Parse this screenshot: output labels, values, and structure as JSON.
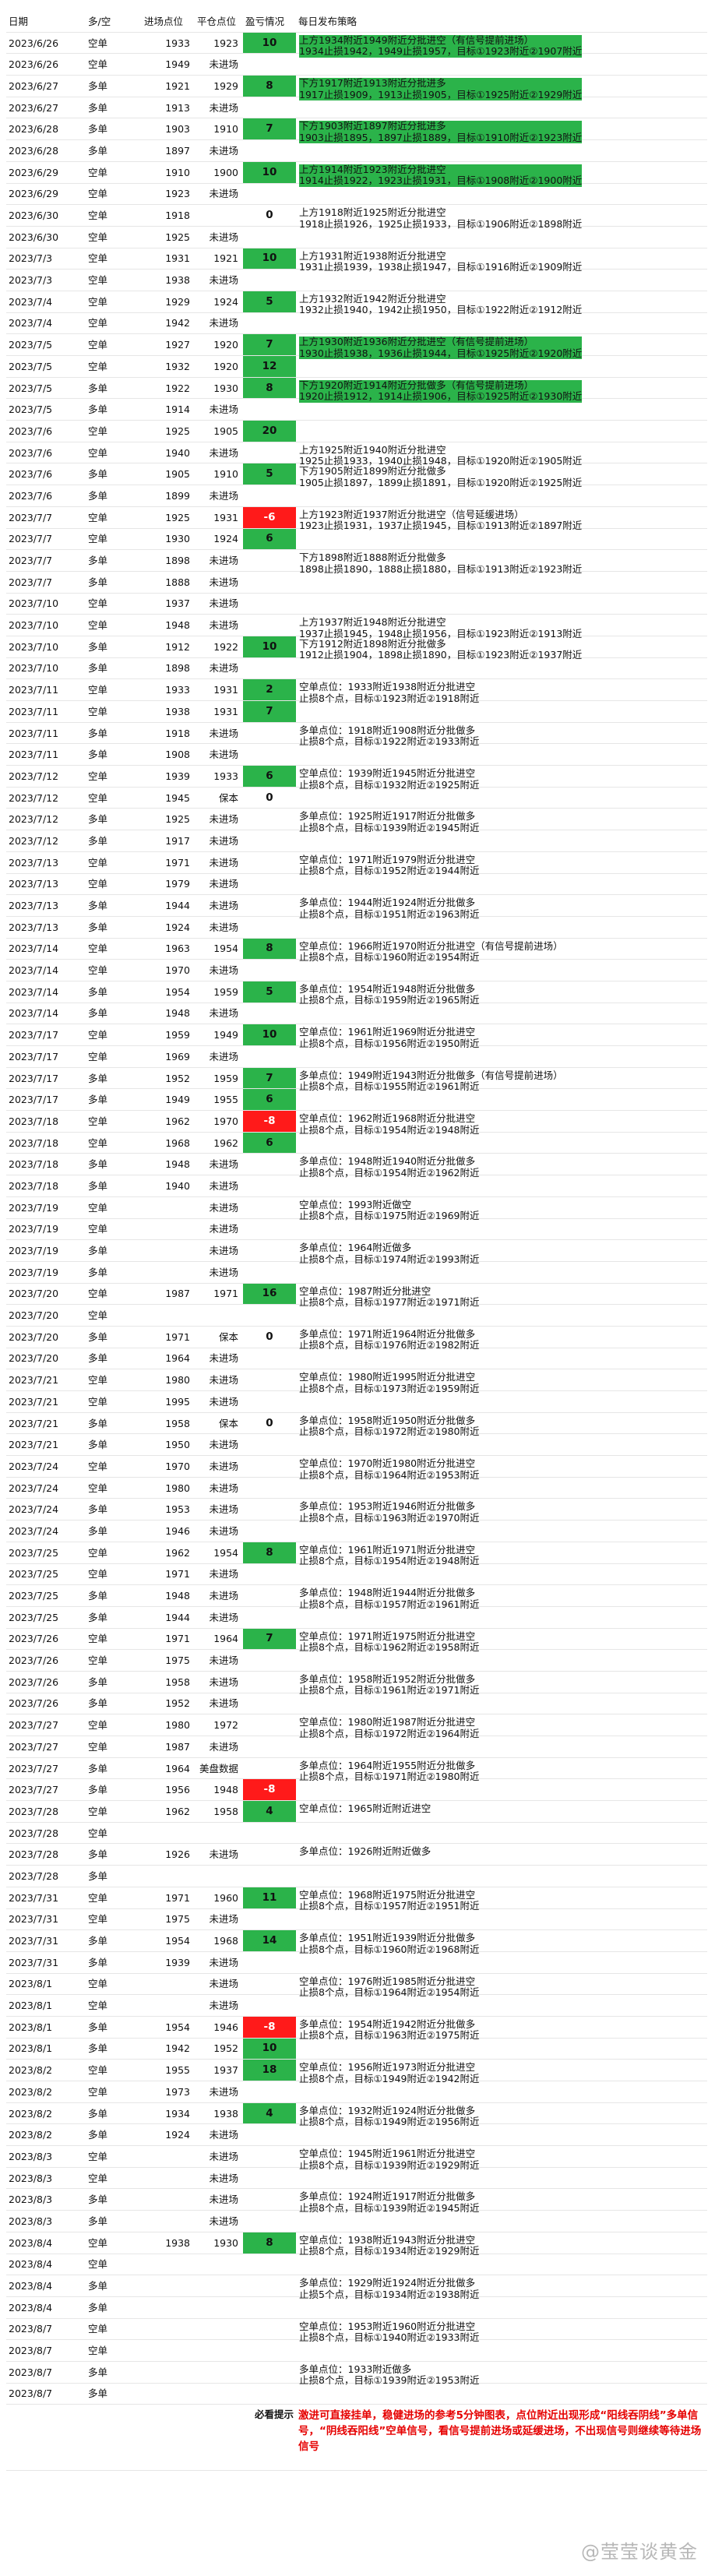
{
  "headers": [
    "日期",
    "多/空",
    "进场点位",
    "平仓点位",
    "盈亏情况",
    "每日发布策略"
  ],
  "rows": [
    {
      "date": "2023/6/26",
      "dir": "空单",
      "entry": "1933",
      "close": "1923",
      "pnl": "10",
      "pnl_type": "pos",
      "note": "上方1934附近1949附近分批进空（有信号提前进场）\n1934止损1942，1949止损1957，目标①1923附近②1907附近",
      "note_hl": true
    },
    {
      "date": "2023/6/26",
      "dir": "空单",
      "entry": "1949",
      "close": "未进场",
      "pnl": "",
      "pnl_type": ""
    },
    {
      "date": "2023/6/27",
      "dir": "多单",
      "entry": "1921",
      "close": "1929",
      "pnl": "8",
      "pnl_type": "pos",
      "note": "下方1917附近1913附近分批进多\n1917止损1909，1913止损1905，目标①1925附近②1929附近",
      "note_hl": true
    },
    {
      "date": "2023/6/27",
      "dir": "多单",
      "entry": "1913",
      "close": "未进场",
      "pnl": "",
      "pnl_type": ""
    },
    {
      "date": "2023/6/28",
      "dir": "多单",
      "entry": "1903",
      "close": "1910",
      "pnl": "7",
      "pnl_type": "pos",
      "note": "下方1903附近1897附近分批进多\n1903止损1895，1897止损1889，目标①1910附近②1923附近",
      "note_hl": true
    },
    {
      "date": "2023/6/28",
      "dir": "多单",
      "entry": "1897",
      "close": "未进场",
      "pnl": "",
      "pnl_type": ""
    },
    {
      "date": "2023/6/29",
      "dir": "空单",
      "entry": "1910",
      "close": "1900",
      "pnl": "10",
      "pnl_type": "pos",
      "note": "上方1914附近1923附近分批进空\n1914止损1922，1923止损1931，目标①1908附近②1900附近",
      "note_hl": true
    },
    {
      "date": "2023/6/29",
      "dir": "空单",
      "entry": "1923",
      "close": "未进场",
      "pnl": "",
      "pnl_type": ""
    },
    {
      "date": "2023/6/30",
      "dir": "空单",
      "entry": "1918",
      "close": "",
      "pnl": "0",
      "pnl_type": "zero",
      "note": "上方1918附近1925附近分批进空\n1918止损1926，1925止损1933，目标①1906附近②1898附近"
    },
    {
      "date": "2023/6/30",
      "dir": "空单",
      "entry": "1925",
      "close": "未进场",
      "pnl": "",
      "pnl_type": ""
    },
    {
      "date": "2023/7/3",
      "dir": "空单",
      "entry": "1931",
      "close": "1921",
      "pnl": "10",
      "pnl_type": "pos",
      "note": "上方1931附近1938附近分批进空\n1931止损1939，1938止损1947，目标①1916附近②1909附近"
    },
    {
      "date": "2023/7/3",
      "dir": "空单",
      "entry": "1938",
      "close": "未进场",
      "pnl": "",
      "pnl_type": ""
    },
    {
      "date": "2023/7/4",
      "dir": "空单",
      "entry": "1929",
      "close": "1924",
      "pnl": "5",
      "pnl_type": "pos",
      "note": "上方1932附近1942附近分批进空\n1932止损1940，1942止损1950，目标①1922附近②1912附近"
    },
    {
      "date": "2023/7/4",
      "dir": "空单",
      "entry": "1942",
      "close": "未进场",
      "pnl": "",
      "pnl_type": ""
    },
    {
      "date": "2023/7/5",
      "dir": "空单",
      "entry": "1927",
      "close": "1920",
      "pnl": "7",
      "pnl_type": "pos",
      "note": "上方1930附近1936附近分批进空（有信号提前进场）\n1930止损1938，1936止损1944，目标①1925附近②1920附近",
      "note_hl": true
    },
    {
      "date": "2023/7/5",
      "dir": "空单",
      "entry": "1932",
      "close": "1920",
      "pnl": "12",
      "pnl_type": "pos"
    },
    {
      "date": "2023/7/5",
      "dir": "多单",
      "entry": "1922",
      "close": "1930",
      "pnl": "8",
      "pnl_type": "pos",
      "note": "下方1920附近1914附近分批做多（有信号提前进场）\n1920止损1912，1914止损1906，目标①1925附近②1930附近",
      "note_hl": true
    },
    {
      "date": "2023/7/5",
      "dir": "多单",
      "entry": "1914",
      "close": "未进场",
      "pnl": "",
      "pnl_type": ""
    },
    {
      "date": "2023/7/6",
      "dir": "空单",
      "entry": "1925",
      "close": "1905",
      "pnl": "20",
      "pnl_type": "pos"
    },
    {
      "date": "2023/7/6",
      "dir": "空单",
      "entry": "1940",
      "close": "未进场",
      "pnl": "",
      "pnl_type": "",
      "note": "上方1925附近1940附近分批进空\n1925止损1933，1940止损1948，目标①1920附近②1905附近"
    },
    {
      "date": "2023/7/6",
      "dir": "多单",
      "entry": "1905",
      "close": "1910",
      "pnl": "5",
      "pnl_type": "pos",
      "note": "下方1905附近1899附近分批做多\n1905止损1897，1899止损1891，目标①1920附近②1925附近"
    },
    {
      "date": "2023/7/6",
      "dir": "多单",
      "entry": "1899",
      "close": "未进场",
      "pnl": "",
      "pnl_type": ""
    },
    {
      "date": "2023/7/7",
      "dir": "空单",
      "entry": "1925",
      "close": "1931",
      "pnl": "-6",
      "pnl_type": "neg",
      "note": "上方1923附近1937附近分批进空（信号延缓进场）\n1923止损1931，1937止损1945，目标①1913附近②1897附近"
    },
    {
      "date": "2023/7/7",
      "dir": "空单",
      "entry": "1930",
      "close": "1924",
      "pnl": "6",
      "pnl_type": "pos"
    },
    {
      "date": "2023/7/7",
      "dir": "多单",
      "entry": "1898",
      "close": "未进场",
      "pnl": "",
      "pnl_type": "",
      "note": "下方1898附近1888附近分批做多\n1898止损1890，1888止损1880，目标①1913附近②1923附近"
    },
    {
      "date": "2023/7/7",
      "dir": "多单",
      "entry": "1888",
      "close": "未进场",
      "pnl": "",
      "pnl_type": ""
    },
    {
      "date": "2023/7/10",
      "dir": "空单",
      "entry": "1937",
      "close": "未进场",
      "pnl": "",
      "pnl_type": ""
    },
    {
      "date": "2023/7/10",
      "dir": "空单",
      "entry": "1948",
      "close": "未进场",
      "pnl": "",
      "pnl_type": "",
      "note": "上方1937附近1948附近分批进空\n1937止损1945，1948止损1956，目标①1923附近②1913附近"
    },
    {
      "date": "2023/7/10",
      "dir": "多单",
      "entry": "1912",
      "close": "1922",
      "pnl": "10",
      "pnl_type": "pos",
      "note": "下方1912附近1898附近分批做多\n1912止损1904，1898止损1890，目标①1923附近②1937附近"
    },
    {
      "date": "2023/7/10",
      "dir": "多单",
      "entry": "1898",
      "close": "未进场",
      "pnl": "",
      "pnl_type": ""
    },
    {
      "date": "2023/7/11",
      "dir": "空单",
      "entry": "1933",
      "close": "1931",
      "pnl": "2",
      "pnl_type": "pos",
      "note": "空单点位：1933附近1938附近分批进空\n止损8个点，目标①1923附近②1918附近"
    },
    {
      "date": "2023/7/11",
      "dir": "空单",
      "entry": "1938",
      "close": "1931",
      "pnl": "7",
      "pnl_type": "pos"
    },
    {
      "date": "2023/7/11",
      "dir": "多单",
      "entry": "1918",
      "close": "未进场",
      "pnl": "",
      "pnl_type": "",
      "note": "多单点位：1918附近1908附近分批做多\n止损8个点，目标①1922附近②1933附近"
    },
    {
      "date": "2023/7/11",
      "dir": "多单",
      "entry": "1908",
      "close": "未进场",
      "pnl": "",
      "pnl_type": ""
    },
    {
      "date": "2023/7/12",
      "dir": "空单",
      "entry": "1939",
      "close": "1933",
      "pnl": "6",
      "pnl_type": "pos",
      "note": "空单点位：1939附近1945附近分批进空\n止损8个点，目标①1932附近②1925附近"
    },
    {
      "date": "2023/7/12",
      "dir": "空单",
      "entry": "1945",
      "close": "保本",
      "pnl": "0",
      "pnl_type": "zero"
    },
    {
      "date": "2023/7/12",
      "dir": "多单",
      "entry": "1925",
      "close": "未进场",
      "pnl": "",
      "pnl_type": "",
      "note": "多单点位：1925附近1917附近分批做多\n止损8个点，目标①1939附近②1945附近"
    },
    {
      "date": "2023/7/12",
      "dir": "多单",
      "entry": "1917",
      "close": "未进场",
      "pnl": "",
      "pnl_type": ""
    },
    {
      "date": "2023/7/13",
      "dir": "空单",
      "entry": "1971",
      "close": "未进场",
      "pnl": "",
      "pnl_type": "",
      "note": "空单点位：1971附近1979附近分批进空\n止损8个点，目标①1952附近②1944附近"
    },
    {
      "date": "2023/7/13",
      "dir": "空单",
      "entry": "1979",
      "close": "未进场",
      "pnl": "",
      "pnl_type": ""
    },
    {
      "date": "2023/7/13",
      "dir": "多单",
      "entry": "1944",
      "close": "未进场",
      "pnl": "",
      "pnl_type": "",
      "note": "多单点位：1944附近1924附近分批做多\n止损8个点，目标①1951附近②1963附近"
    },
    {
      "date": "2023/7/13",
      "dir": "多单",
      "entry": "1924",
      "close": "未进场",
      "pnl": "",
      "pnl_type": ""
    },
    {
      "date": "2023/7/14",
      "dir": "空单",
      "entry": "1963",
      "close": "1954",
      "pnl": "8",
      "pnl_type": "pos",
      "note": "空单点位：1966附近1970附近分批进空（有信号提前进场）\n止损8个点，目标①1960附近②1954附近"
    },
    {
      "date": "2023/7/14",
      "dir": "空单",
      "entry": "1970",
      "close": "未进场",
      "pnl": "",
      "pnl_type": ""
    },
    {
      "date": "2023/7/14",
      "dir": "多单",
      "entry": "1954",
      "close": "1959",
      "pnl": "5",
      "pnl_type": "pos",
      "note": "多单点位：1954附近1948附近分批做多\n止损8个点，目标①1959附近②1965附近"
    },
    {
      "date": "2023/7/14",
      "dir": "多单",
      "entry": "1948",
      "close": "未进场",
      "pnl": "",
      "pnl_type": ""
    },
    {
      "date": "2023/7/17",
      "dir": "空单",
      "entry": "1959",
      "close": "1949",
      "pnl": "10",
      "pnl_type": "pos",
      "note": "空单点位：1961附近1969附近分批进空\n止损8个点，目标①1956附近②1950附近"
    },
    {
      "date": "2023/7/17",
      "dir": "空单",
      "entry": "1969",
      "close": "未进场",
      "pnl": "",
      "pnl_type": ""
    },
    {
      "date": "2023/7/17",
      "dir": "多单",
      "entry": "1952",
      "close": "1959",
      "pnl": "7",
      "pnl_type": "pos",
      "note": "多单点位：1949附近1943附近分批做多（有信号提前进场）\n止损8个点，目标①1955附近②1961附近"
    },
    {
      "date": "2023/7/17",
      "dir": "多单",
      "entry": "1949",
      "close": "1955",
      "pnl": "6",
      "pnl_type": "pos"
    },
    {
      "date": "2023/7/18",
      "dir": "空单",
      "entry": "1962",
      "close": "1970",
      "pnl": "-8",
      "pnl_type": "neg",
      "note": "空单点位：1962附近1968附近分批进空\n止损8个点，目标①1954附近②1948附近"
    },
    {
      "date": "2023/7/18",
      "dir": "空单",
      "entry": "1968",
      "close": "1962",
      "pnl": "6",
      "pnl_type": "pos"
    },
    {
      "date": "2023/7/18",
      "dir": "多单",
      "entry": "1948",
      "close": "未进场",
      "pnl": "",
      "pnl_type": "",
      "note": "多单点位：1948附近1940附近分批做多\n止损8个点，目标①1954附近②1962附近"
    },
    {
      "date": "2023/7/18",
      "dir": "多单",
      "entry": "1940",
      "close": "未进场",
      "pnl": "",
      "pnl_type": ""
    },
    {
      "date": "2023/7/19",
      "dir": "空单",
      "entry": "",
      "close": "未进场",
      "pnl": "",
      "pnl_type": "",
      "note": "空单点位：1993附近做空\n止损8个点，目标①1975附近②1969附近"
    },
    {
      "date": "2023/7/19",
      "dir": "空单",
      "entry": "",
      "close": "未进场",
      "pnl": "",
      "pnl_type": ""
    },
    {
      "date": "2023/7/19",
      "dir": "多单",
      "entry": "",
      "close": "未进场",
      "pnl": "",
      "pnl_type": "",
      "note": "多单点位：1964附近做多\n止损8个点，目标①1974附近②1993附近"
    },
    {
      "date": "2023/7/19",
      "dir": "多单",
      "entry": "",
      "close": "未进场",
      "pnl": "",
      "pnl_type": ""
    },
    {
      "date": "2023/7/20",
      "dir": "空单",
      "entry": "1987",
      "close": "1971",
      "pnl": "16",
      "pnl_type": "pos",
      "note": "空单点位：1987附近分批进空\n止损8个点，目标①1977附近②1971附近"
    },
    {
      "date": "2023/7/20",
      "dir": "空单",
      "entry": "",
      "close": "",
      "pnl": "",
      "pnl_type": ""
    },
    {
      "date": "2023/7/20",
      "dir": "多单",
      "entry": "1971",
      "close": "保本",
      "pnl": "0",
      "pnl_type": "zero",
      "note": "多单点位：1971附近1964附近分批做多\n止损8个点，目标①1976附近②1982附近"
    },
    {
      "date": "2023/7/20",
      "dir": "多单",
      "entry": "1964",
      "close": "未进场",
      "pnl": "",
      "pnl_type": ""
    },
    {
      "date": "2023/7/21",
      "dir": "空单",
      "entry": "1980",
      "close": "未进场",
      "pnl": "",
      "pnl_type": "",
      "note": "空单点位：1980附近1995附近分批进空\n止损8个点，目标①1973附近②1959附近"
    },
    {
      "date": "2023/7/21",
      "dir": "空单",
      "entry": "1995",
      "close": "未进场",
      "pnl": "",
      "pnl_type": ""
    },
    {
      "date": "2023/7/21",
      "dir": "多单",
      "entry": "1958",
      "close": "保本",
      "pnl": "0",
      "pnl_type": "zero",
      "note": "多单点位：1958附近1950附近分批做多\n止损8个点，目标①1972附近②1980附近"
    },
    {
      "date": "2023/7/21",
      "dir": "多单",
      "entry": "1950",
      "close": "未进场",
      "pnl": "",
      "pnl_type": ""
    },
    {
      "date": "2023/7/24",
      "dir": "空单",
      "entry": "1970",
      "close": "未进场",
      "pnl": "",
      "pnl_type": "",
      "note": "空单点位：1970附近1980附近分批进空\n止损8个点，目标①1964附近②1953附近"
    },
    {
      "date": "2023/7/24",
      "dir": "空单",
      "entry": "1980",
      "close": "未进场",
      "pnl": "",
      "pnl_type": ""
    },
    {
      "date": "2023/7/24",
      "dir": "多单",
      "entry": "1953",
      "close": "未进场",
      "pnl": "",
      "pnl_type": "",
      "note": "多单点位：1953附近1946附近分批做多\n止损8个点，目标①1963附近②1970附近"
    },
    {
      "date": "2023/7/24",
      "dir": "多单",
      "entry": "1946",
      "close": "未进场",
      "pnl": "",
      "pnl_type": ""
    },
    {
      "date": "2023/7/25",
      "dir": "空单",
      "entry": "1962",
      "close": "1954",
      "pnl": "8",
      "pnl_type": "pos",
      "note": "空单点位：1961附近1971附近分批进空\n止损8个点，目标①1954附近②1948附近"
    },
    {
      "date": "2023/7/25",
      "dir": "空单",
      "entry": "1971",
      "close": "未进场",
      "pnl": "",
      "pnl_type": ""
    },
    {
      "date": "2023/7/25",
      "dir": "多单",
      "entry": "1948",
      "close": "未进场",
      "pnl": "",
      "pnl_type": "",
      "note": "多单点位：1948附近1944附近分批做多\n止损8个点，目标①1957附近②1961附近"
    },
    {
      "date": "2023/7/25",
      "dir": "多单",
      "entry": "1944",
      "close": "未进场",
      "pnl": "",
      "pnl_type": ""
    },
    {
      "date": "2023/7/26",
      "dir": "空单",
      "entry": "1971",
      "close": "1964",
      "pnl": "7",
      "pnl_type": "pos",
      "note": "空单点位：1971附近1975附近分批进空\n止损8个点，目标①1962附近②1958附近"
    },
    {
      "date": "2023/7/26",
      "dir": "空单",
      "entry": "1975",
      "close": "未进场",
      "pnl": "",
      "pnl_type": ""
    },
    {
      "date": "2023/7/26",
      "dir": "多单",
      "entry": "1958",
      "close": "未进场",
      "pnl": "",
      "pnl_type": "",
      "note": "多单点位：1958附近1952附近分批做多\n止损8个点，目标①1961附近②1971附近"
    },
    {
      "date": "2023/7/26",
      "dir": "多单",
      "entry": "1952",
      "close": "未进场",
      "pnl": "",
      "pnl_type": ""
    },
    {
      "date": "2023/7/27",
      "dir": "空单",
      "entry": "1980",
      "close": "1972",
      "pnl": "",
      "pnl_type": "",
      "note": "空单点位：1980附近1987附近分批进空\n止损8个点，目标①1972附近②1964附近"
    },
    {
      "date": "2023/7/27",
      "dir": "空单",
      "entry": "1987",
      "close": "未进场",
      "pnl": "",
      "pnl_type": ""
    },
    {
      "date": "2023/7/27",
      "dir": "多单",
      "entry": "1964",
      "close": "美盘数据",
      "pnl": "",
      "pnl_type": "",
      "note": "多单点位：1964附近1955附近分批做多\n止损8个点，目标①1971附近②1980附近"
    },
    {
      "date": "2023/7/27",
      "dir": "多单",
      "entry": "1956",
      "close": "1948",
      "pnl": "-8",
      "pnl_type": "neg"
    },
    {
      "date": "2023/7/28",
      "dir": "空单",
      "entry": "1962",
      "close": "1958",
      "pnl": "4",
      "pnl_type": "pos",
      "note": "空单点位：1965附近附近进空"
    },
    {
      "date": "2023/7/28",
      "dir": "空单",
      "entry": "",
      "close": "",
      "pnl": "",
      "pnl_type": ""
    },
    {
      "date": "2023/7/28",
      "dir": "多单",
      "entry": "1926",
      "close": "未进场",
      "pnl": "",
      "pnl_type": "",
      "note": "多单点位：1926附近附近做多"
    },
    {
      "date": "2023/7/28",
      "dir": "多单",
      "entry": "",
      "close": "",
      "pnl": "",
      "pnl_type": ""
    },
    {
      "date": "2023/7/31",
      "dir": "空单",
      "entry": "1971",
      "close": "1960",
      "pnl": "11",
      "pnl_type": "pos",
      "note": "空单点位：1968附近1975附近分批进空\n止损8个点，目标①1957附近②1951附近"
    },
    {
      "date": "2023/7/31",
      "dir": "空单",
      "entry": "1975",
      "close": "未进场",
      "pnl": "",
      "pnl_type": ""
    },
    {
      "date": "2023/7/31",
      "dir": "多单",
      "entry": "1954",
      "close": "1968",
      "pnl": "14",
      "pnl_type": "pos",
      "note": "多单点位：1951附近1939附近分批做多\n止损8个点，目标①1960附近②1968附近"
    },
    {
      "date": "2023/7/31",
      "dir": "多单",
      "entry": "1939",
      "close": "未进场",
      "pnl": "",
      "pnl_type": ""
    },
    {
      "date": "2023/8/1",
      "dir": "空单",
      "entry": "",
      "close": "未进场",
      "pnl": "",
      "pnl_type": "",
      "note": "空单点位：1976附近1985附近分批进空\n止损8个点，目标①1964附近②1954附近"
    },
    {
      "date": "2023/8/1",
      "dir": "空单",
      "entry": "",
      "close": "未进场",
      "pnl": "",
      "pnl_type": ""
    },
    {
      "date": "2023/8/1",
      "dir": "多单",
      "entry": "1954",
      "close": "1946",
      "pnl": "-8",
      "pnl_type": "neg",
      "note": "多单点位：1954附近1942附近分批做多\n止损8个点，目标①1963附近②1975附近"
    },
    {
      "date": "2023/8/1",
      "dir": "多单",
      "entry": "1942",
      "close": "1952",
      "pnl": "10",
      "pnl_type": "pos"
    },
    {
      "date": "2023/8/2",
      "dir": "空单",
      "entry": "1955",
      "close": "1937",
      "pnl": "18",
      "pnl_type": "pos",
      "note": "空单点位：1956附近1973附近分批进空\n止损8个点，目标①1949附近②1942附近"
    },
    {
      "date": "2023/8/2",
      "dir": "空单",
      "entry": "1973",
      "close": "未进场",
      "pnl": "",
      "pnl_type": ""
    },
    {
      "date": "2023/8/2",
      "dir": "多单",
      "entry": "1934",
      "close": "1938",
      "pnl": "4",
      "pnl_type": "pos",
      "note": "多单点位：1932附近1924附近分批做多\n止损8个点，目标①1949附近②1956附近"
    },
    {
      "date": "2023/8/2",
      "dir": "多单",
      "entry": "1924",
      "close": "未进场",
      "pnl": "",
      "pnl_type": ""
    },
    {
      "date": "2023/8/3",
      "dir": "空单",
      "entry": "",
      "close": "未进场",
      "pnl": "",
      "pnl_type": "",
      "note": "空单点位：1945附近1961附近分批进空\n止损8个点，目标①1939附近②1929附近"
    },
    {
      "date": "2023/8/3",
      "dir": "空单",
      "entry": "",
      "close": "未进场",
      "pnl": "",
      "pnl_type": ""
    },
    {
      "date": "2023/8/3",
      "dir": "多单",
      "entry": "",
      "close": "未进场",
      "pnl": "",
      "pnl_type": "",
      "note": "多单点位：1924附近1917附近分批做多\n止损8个点，目标①1939附近②1945附近"
    },
    {
      "date": "2023/8/3",
      "dir": "多单",
      "entry": "",
      "close": "未进场",
      "pnl": "",
      "pnl_type": ""
    },
    {
      "date": "2023/8/4",
      "dir": "空单",
      "entry": "1938",
      "close": "1930",
      "pnl": "8",
      "pnl_type": "pos",
      "note": "空单点位：1938附近1943附近分批进空\n止损8个点，目标①1934附近②1929附近"
    },
    {
      "date": "2023/8/4",
      "dir": "空单",
      "entry": "",
      "close": "",
      "pnl": "",
      "pnl_type": ""
    },
    {
      "date": "2023/8/4",
      "dir": "多单",
      "entry": "",
      "close": "",
      "pnl": "",
      "pnl_type": "",
      "note": "多单点位：1929附近1924附近分批做多\n止损5个点，目标①1934附近②1938附近"
    },
    {
      "date": "2023/8/4",
      "dir": "多单",
      "entry": "",
      "close": "",
      "pnl": "",
      "pnl_type": ""
    },
    {
      "date": "2023/8/7",
      "dir": "空单",
      "entry": "",
      "close": "",
      "pnl": "",
      "pnl_type": "",
      "note": "空单点位：1953附近1960附近分批进空\n止损8个点，目标①1940附近②1933附近"
    },
    {
      "date": "2023/8/7",
      "dir": "空单",
      "entry": "",
      "close": "",
      "pnl": "",
      "pnl_type": ""
    },
    {
      "date": "2023/8/7",
      "dir": "多单",
      "entry": "",
      "close": "",
      "pnl": "",
      "pnl_type": "",
      "note": "多单点位：1933附近做多\n止损8个点，目标①1939附近②1953附近"
    },
    {
      "date": "2023/8/7",
      "dir": "多单",
      "entry": "",
      "close": "",
      "pnl": "",
      "pnl_type": ""
    }
  ],
  "tip": {
    "label": "必看提示",
    "text": "激进可直接挂单，稳健进场的参考5分钟图表，点位附近出现形成“阳线吞阴线”多单信号，“阴线吞阳线”空单信号，看信号提前进场或延缓进场，不出现信号则继续等待进场信号"
  },
  "watermark": "@莹莹谈黄金",
  "colors": {
    "profit": "#2bb34a",
    "loss": "#ff1a1a",
    "tip_text": "#e60000"
  }
}
